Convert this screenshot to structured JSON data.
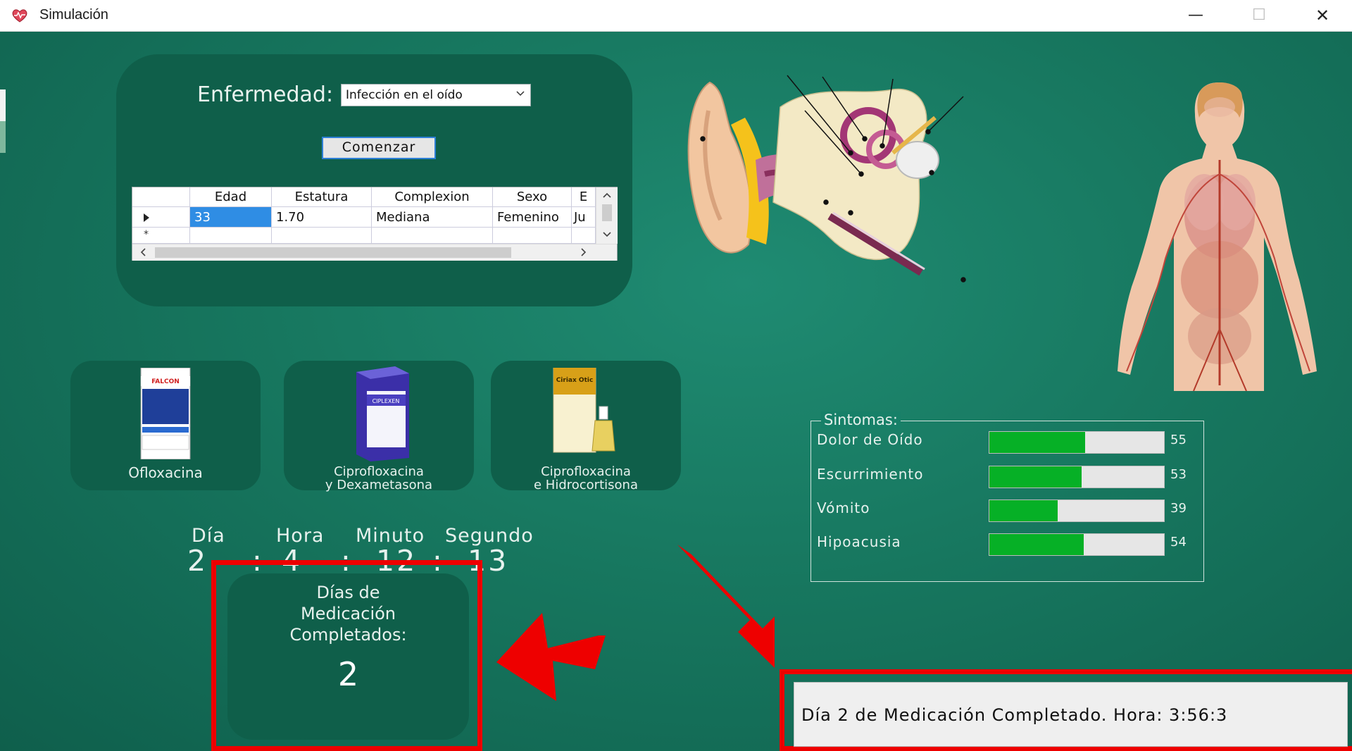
{
  "window": {
    "title": "Simulación",
    "minimize": "—",
    "maximize": "☐",
    "close": "✕"
  },
  "form": {
    "disease_label": "Enfermedad:",
    "disease_value": "Infección en el oído",
    "start_button": "Comenzar"
  },
  "grid": {
    "columns": [
      "Edad",
      "Estatura",
      "Complexion",
      "Sexo",
      "E"
    ],
    "rows": [
      [
        "33",
        "1.70",
        "Mediana",
        "Femenino",
        "Ju"
      ]
    ],
    "new_row_marker": "*"
  },
  "medications": [
    {
      "name": "Ofloxacina",
      "label1": "Ofloxacina",
      "label2": "",
      "box_text": "FALCON"
    },
    {
      "name": "Ciprofloxacina y Dexametasona",
      "label1": "Ciprofloxacina",
      "label2": "y Dexametasona",
      "box_text": "CIPLEXEN"
    },
    {
      "name": "Ciprofloxacina e Hidrocortisona",
      "label1": "Ciprofloxacina",
      "label2": "e Hidrocortisona",
      "box_text": "Ciriax Otic"
    }
  ],
  "clock": {
    "labels": {
      "day": "Día",
      "hour": "Hora",
      "minute": "Minuto",
      "second": "Segundo"
    },
    "values": {
      "day": "2",
      "hour": "4",
      "minute": "12",
      "second": "13"
    },
    "separator": ":"
  },
  "medication_days": {
    "title_line1": "Días de",
    "title_line2": "Medicación",
    "title_line3": "Completados:",
    "value": "2"
  },
  "symptoms": {
    "legend": "Sintomas:",
    "items": [
      {
        "name": "Dolor de Oído",
        "value": 55,
        "label": "55"
      },
      {
        "name": "Escurrimiento",
        "value": 53,
        "label": "53"
      },
      {
        "name": "Vómito",
        "value": 39,
        "label": "39"
      },
      {
        "name": "Hipoacusia",
        "value": 54,
        "label": "54"
      }
    ],
    "max": 100
  },
  "status_message": "Día 2 de Medicación Completado. Hora: 3:56:3",
  "colors": {
    "panel": "#0f5f4a",
    "background": "#17775f",
    "highlight": "#ee0000",
    "bar_fill": "#06b026",
    "selection": "#2f8de4"
  }
}
